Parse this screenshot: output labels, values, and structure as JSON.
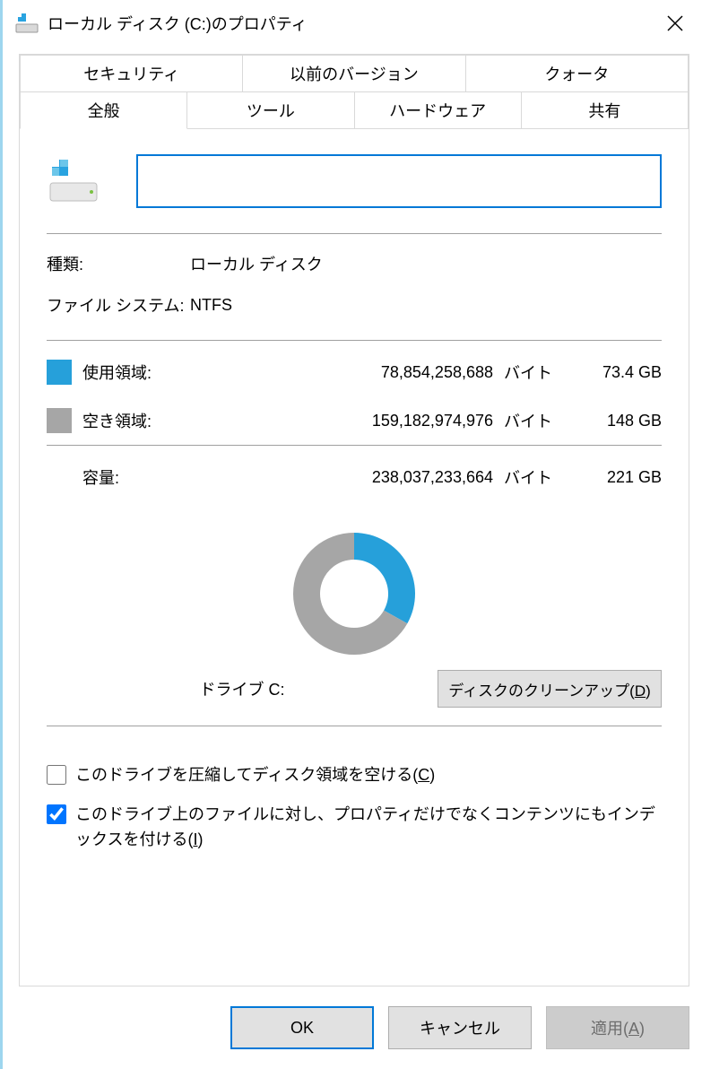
{
  "titlebar": {
    "title": "ローカル ディスク (C:)のプロパティ"
  },
  "tabs": {
    "security": "セキュリティ",
    "previous_versions": "以前のバージョン",
    "quota": "クォータ",
    "general": "全般",
    "tools": "ツール",
    "hardware": "ハードウェア",
    "sharing": "共有"
  },
  "general": {
    "name_value": "",
    "type_label": "種類:",
    "type_value": "ローカル ディスク",
    "fs_label": "ファイル システム:",
    "fs_value": "NTFS",
    "used_label": "使用領域:",
    "used_bytes": "78,854,258,688",
    "used_gb": "73.4 GB",
    "free_label": "空き領域:",
    "free_bytes": "159,182,974,976",
    "free_gb": "148 GB",
    "capacity_label": "容量:",
    "capacity_bytes": "238,037,233,664",
    "capacity_gb": "221 GB",
    "bytes_unit": "バイト",
    "drive_label": "ドライブ C:",
    "cleanup_label_pre": "ディスクのクリーンアップ(",
    "cleanup_mnemonic": "D",
    "cleanup_label_post": ")",
    "compress_pre": "このドライブを圧縮してディスク領域を空ける(",
    "compress_mnemonic": "C",
    "compress_post": ")",
    "index_pre": "このドライブ上のファイルに対し、プロパティだけでなくコンテンツにもインデックスを付ける(",
    "index_mnemonic": "I",
    "index_post": ")",
    "compress_checked": false,
    "index_checked": true
  },
  "buttons": {
    "ok": "OK",
    "cancel": "キャンセル",
    "apply_pre": "適用(",
    "apply_mnemonic": "A",
    "apply_post": ")"
  },
  "colors": {
    "used": "#26a0da",
    "free": "#a6a6a6",
    "accent": "#0078d7"
  },
  "chart_data": {
    "type": "pie",
    "title": "ドライブ C:",
    "series": [
      {
        "name": "使用領域",
        "value": 78854258688,
        "color": "#26a0da"
      },
      {
        "name": "空き領域",
        "value": 159182974976,
        "color": "#a6a6a6"
      }
    ],
    "total": 238037233664
  }
}
